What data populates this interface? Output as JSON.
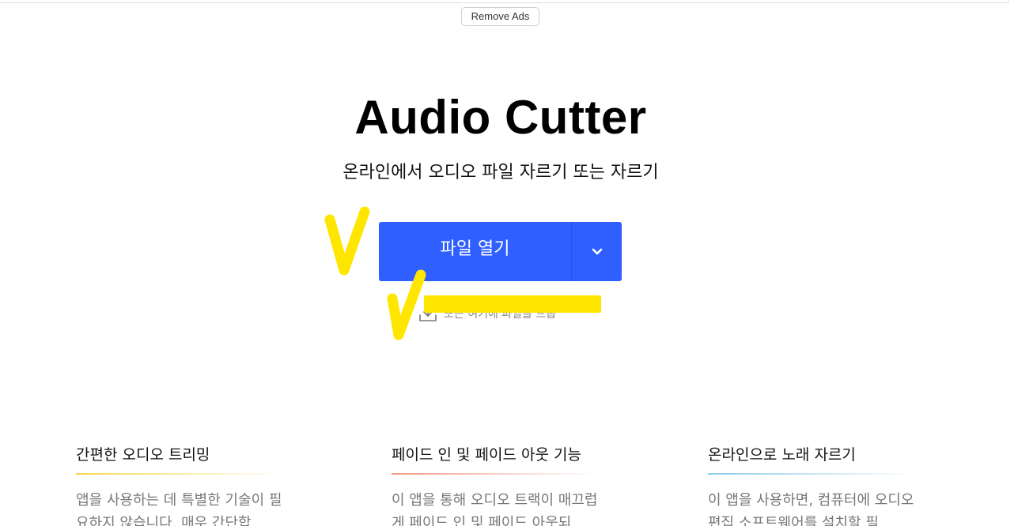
{
  "header": {
    "remove_ads_label": "Remove Ads"
  },
  "hero": {
    "title": "Audio Cutter",
    "subtitle": "온라인에서 오디오 파일 자르기 또는 자르기"
  },
  "open_button": {
    "label": "파일 열기",
    "dropdown_icon": "chevron-down-icon"
  },
  "drop_hint": {
    "icon": "download-icon",
    "text": "또는 여기에 파일을 드롭"
  },
  "features": [
    {
      "title": "간편한 오디오 트리밍",
      "text": "앱을 사용하는 데 특별한 기술이 필요하지 않습니다. 매우 간단합",
      "accent": "#f7d84a"
    },
    {
      "title": "페이드 인 및 페이드 아웃 기능",
      "text": "이 앱을 통해 오디오 트랙이 매끄럽게 페이드 인 및 페이드 아웃되",
      "accent": "#f29a85"
    },
    {
      "title": "온라인으로 노래 자르기",
      "text": "이 앱을 사용하면, 컴퓨터에 오디오 편집 소프트웨어를 설치할 필",
      "accent": "#8ccbea"
    }
  ],
  "colors": {
    "primary": "#2f60ff",
    "highlight": "#ffe600"
  }
}
